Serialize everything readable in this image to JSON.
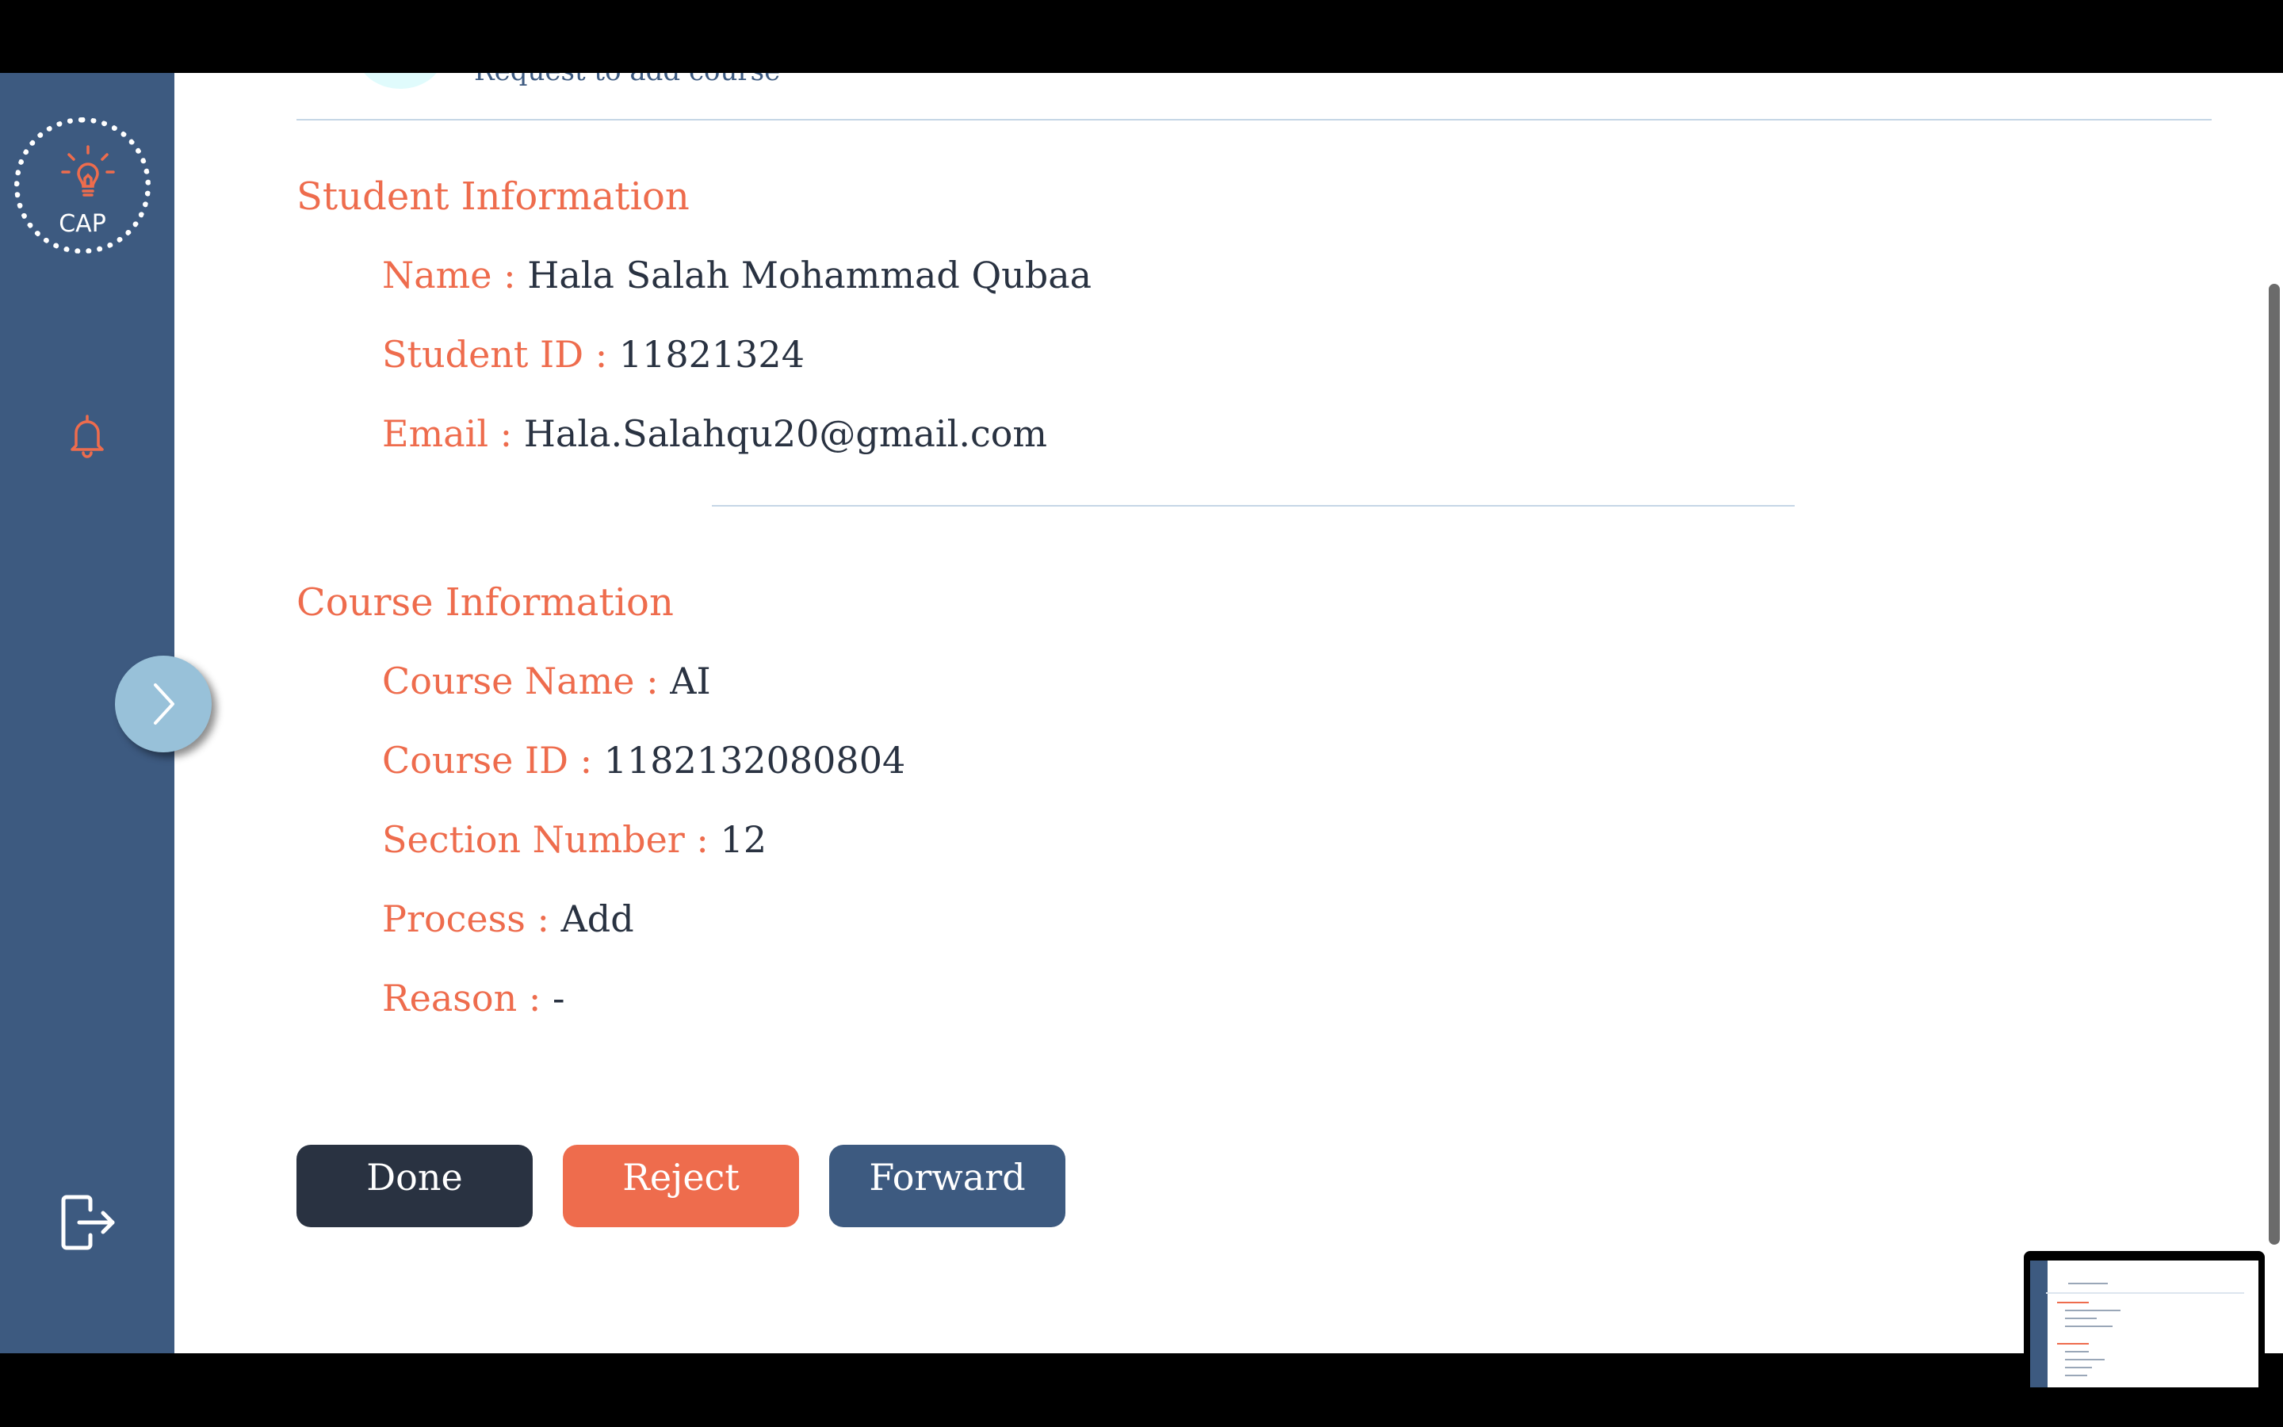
{
  "app": {
    "logo_text": "CAP",
    "accent": "#ee6c4d",
    "sidebar_color": "#3d5a80",
    "dark": "#293241"
  },
  "header": {
    "subtitle": "Request to add course"
  },
  "student": {
    "section_title": "Student Information",
    "name_label": "Name :",
    "name_value": "Hala Salah Mohammad Qubaa",
    "id_label": "Student ID :",
    "id_value": "11821324",
    "email_label": "Email :",
    "email_value": "Hala.Salahqu20@gmail.com"
  },
  "course": {
    "section_title": "Course Information",
    "name_label": "Course Name :",
    "name_value": "AI",
    "id_label": "Course ID :",
    "id_value": "1182132080804",
    "section_label": "Section Number :",
    "section_value": "12",
    "process_label": "Process  :",
    "process_value": "Add",
    "reason_label": "Reason   :",
    "reason_value": "-"
  },
  "actions": {
    "done": "Done",
    "reject": "Reject",
    "forward": "Forward"
  },
  "icons": {
    "logo": "lightbulb-icon",
    "bell": "bell-icon",
    "logout": "logout-icon",
    "expand": "chevron-right-icon"
  }
}
